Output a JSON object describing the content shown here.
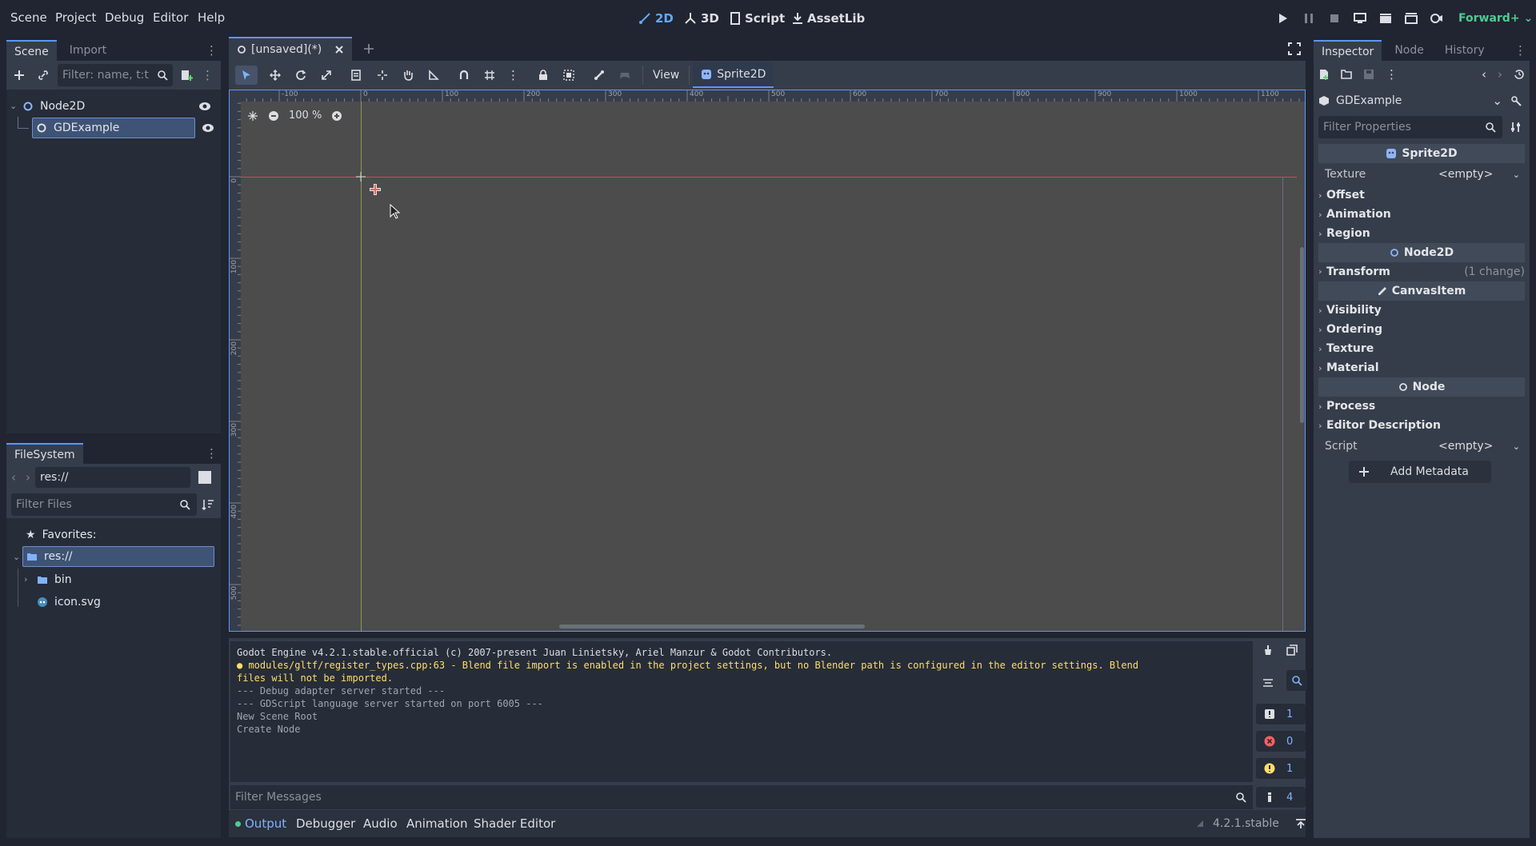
{
  "menu": [
    "Scene",
    "Project",
    "Debug",
    "Editor",
    "Help"
  ],
  "modes": [
    {
      "label": "2D",
      "icon": "2d-icon",
      "active": true
    },
    {
      "label": "3D",
      "icon": "3d-icon"
    },
    {
      "label": "Script",
      "icon": "script-icon"
    },
    {
      "label": "AssetLib",
      "icon": "assetlib-icon"
    }
  ],
  "renderer": "Forward+",
  "scene_dock": {
    "tabs": [
      "Scene",
      "Import"
    ],
    "filter_placeholder": "Filter: name, t:t",
    "nodes": [
      {
        "label": "Node2D"
      },
      {
        "label": "GDExample",
        "selected": true
      }
    ]
  },
  "filesystem": {
    "tab": "FileSystem",
    "path": "res://",
    "filter_placeholder": "Filter Files",
    "favorites": "Favorites:",
    "items": [
      {
        "label": "res://",
        "selected": true
      },
      {
        "label": "bin"
      },
      {
        "label": "icon.svg"
      }
    ]
  },
  "editor": {
    "scene_tab": "[unsaved](*)",
    "view_label": "View",
    "node_button": "Sprite2D",
    "zoom": "100 %",
    "ruler_h": [
      "-100",
      "0",
      "100",
      "200",
      "300",
      "400",
      "500",
      "600",
      "700",
      "800",
      "900",
      "1000",
      "1100"
    ],
    "ruler_v": [
      "0",
      "100",
      "200",
      "300",
      "400",
      "500"
    ]
  },
  "output": {
    "lines": [
      {
        "text": "Godot Engine v4.2.1.stable.official (c) 2007-present Juan Linietsky, Ariel Manzur & Godot Contributors.",
        "kind": "info"
      },
      {
        "text": "modules/gltf/register_types.cpp:63 - Blend file import is enabled in the project settings, but no Blender path is configured in the editor settings. Blend",
        "kind": "warning"
      },
      {
        "text": "files will not be imported.",
        "kind": "warning"
      },
      {
        "text": "--- Debug adapter server started ---",
        "kind": "dim"
      },
      {
        "text": "--- GDScript language server started on port 6005 ---",
        "kind": "dim"
      },
      {
        "text": "New Scene Root",
        "kind": "dim"
      },
      {
        "text": "Create Node",
        "kind": "dim"
      }
    ],
    "filter_placeholder": "Filter Messages",
    "counts": {
      "log": "1",
      "errors": "0",
      "warnings": "1",
      "messages": "4"
    }
  },
  "bottom_tabs": [
    "Output",
    "Debugger",
    "Audio",
    "Animation",
    "Shader Editor"
  ],
  "version": "4.2.1.stable",
  "inspector": {
    "tabs": [
      "Inspector",
      "Node",
      "History"
    ],
    "object": "GDExample",
    "filter_placeholder": "Filter Properties",
    "sprite_section": "Sprite2D",
    "texture_label": "Texture",
    "texture_value": "<empty>",
    "sprite_groups": [
      "Offset",
      "Animation",
      "Region"
    ],
    "node2d_section": "Node2D",
    "transform_label": "Transform",
    "transform_note": "(1 change)",
    "canvas_section": "CanvasItem",
    "canvas_groups": [
      "Visibility",
      "Ordering",
      "Texture",
      "Material"
    ],
    "node_section": "Node",
    "node_groups": [
      "Process",
      "Editor Description"
    ],
    "script_label": "Script",
    "script_value": "<empty>",
    "add_metadata": "Add Metadata"
  },
  "colors": {
    "accent": "#5e95ff",
    "warning": "#ffde66",
    "error": "#ff5f5f",
    "selected": "#3e5376",
    "canvas": "#4c4c4c"
  }
}
